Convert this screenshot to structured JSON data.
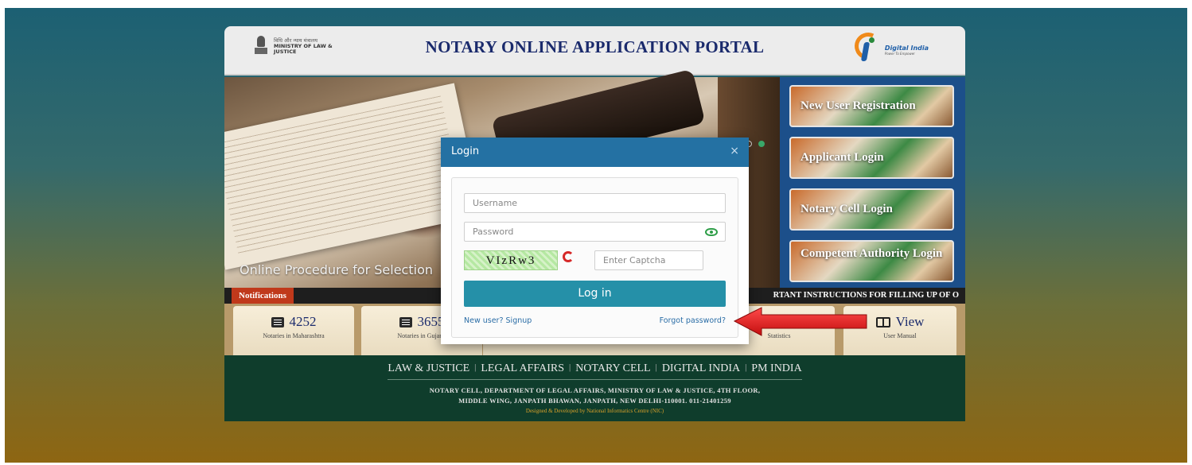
{
  "header": {
    "ministry_hindi": "विधि और न्याय मंत्रालय",
    "ministry_line1": "MINISTRY OF LAW &",
    "ministry_line2": "JUSTICE",
    "title": "NOTARY ONLINE APPLICATION PORTAL",
    "digital_india": "Digital India",
    "digital_india_tagline": "Power To Empower"
  },
  "slider": {
    "caption": "Online Procedure for Selection",
    "dots": 3,
    "active_dot": 3
  },
  "right_panel": {
    "new_user": "New User Registration",
    "applicant_login": "Applicant Login",
    "notary_cell_login": "Notary Cell Login",
    "competent_authority_login": "Competent Authority Login"
  },
  "ticker": {
    "tab": "Notifications",
    "text": "RTANT INSTRUCTIONS FOR FILLING UP OF O"
  },
  "stats": [
    {
      "value": "4252",
      "label": "Notaries in Maharashtra"
    },
    {
      "value": "3655",
      "label": "Notaries in Gujarat"
    },
    {
      "value": "",
      "label": ""
    },
    {
      "value": "",
      "label": ""
    },
    {
      "value": "",
      "label": "Statistics"
    },
    {
      "value": "View",
      "label": "User Manual"
    }
  ],
  "footer": {
    "links": [
      "LAW & JUSTICE",
      "LEGAL AFFAIRS",
      "NOTARY CELL",
      "DIGITAL INDIA",
      "PM INDIA"
    ],
    "address_line1": "NOTARY CELL, DEPARTMENT OF LEGAL AFFAIRS, MINISTRY OF LAW & JUSTICE, 4TH FLOOR,",
    "address_line2": "MIDDLE WING, JANPATH BHAWAN, JANPATH, NEW DELHI-110001. 011-21401259",
    "credit": "Designed & Developed by National Informatics Centre (NIC)"
  },
  "modal": {
    "title": "Login",
    "close": "×",
    "username_placeholder": "Username",
    "password_placeholder": "Password",
    "captcha_text": "VIzRw3",
    "captcha_placeholder": "Enter Captcha",
    "login_button": "Log in",
    "signup_link": "New user? Signup",
    "forgot_link": "Forgot password?"
  },
  "colors": {
    "modal_header": "#2471a3",
    "login_button": "#2590a8",
    "footer_bg": "#0f3d2c",
    "arrow": "#e11a1a"
  }
}
